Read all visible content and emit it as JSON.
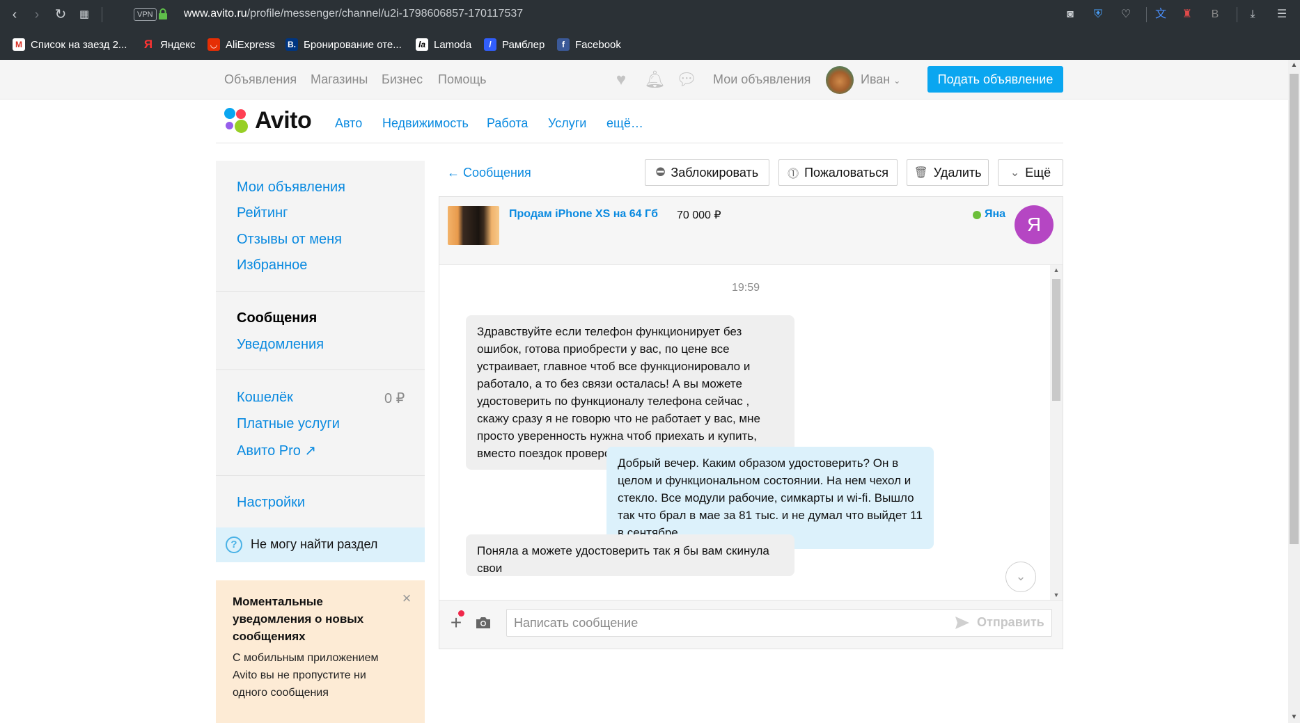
{
  "browser": {
    "vpn_label": "VPN",
    "url_domain": "www.avito.ru",
    "url_path": "/profile/messenger/channel/u2i-1798606857-170117537",
    "bookmarks": [
      {
        "label": "Список на заезд 2...",
        "icon": "gmail-icon",
        "color": "#d93025"
      },
      {
        "label": "Яндекс",
        "icon": "yandex-icon",
        "color": "#ff0000"
      },
      {
        "label": "AliExpress",
        "icon": "aliexpress-icon",
        "color": "#e62e04"
      },
      {
        "label": "Бронирование оте...",
        "icon": "booking-icon",
        "color": "#003580"
      },
      {
        "label": "Lamoda",
        "icon": "lamoda-icon",
        "color": "#000000"
      },
      {
        "label": "Рамблер",
        "icon": "rambler-icon",
        "color": "#315efb"
      },
      {
        "label": "Facebook",
        "icon": "facebook-icon",
        "color": "#3b5998"
      }
    ]
  },
  "topbar": {
    "links": [
      "Объявления",
      "Магазины",
      "Бизнес",
      "Помощь"
    ],
    "my_ads": "Мои объявления",
    "user_name": "Иван",
    "post_button": "Подать объявление"
  },
  "header": {
    "logo_text": "Avito",
    "categories": [
      "Авто",
      "Недвижимость",
      "Работа",
      "Услуги",
      "ещё…"
    ]
  },
  "sidebar": {
    "group1": [
      "Мои объявления",
      "Рейтинг",
      "Отзывы от меня",
      "Избранное"
    ],
    "messages_active": "Сообщения",
    "notifications": "Уведомления",
    "wallet_label": "Кошелёк",
    "wallet_value": "0 ₽",
    "paid_services": "Платные услуги",
    "avito_pro": "Авито Pro ↗",
    "settings": "Настройки",
    "help": "Не могу найти раздел"
  },
  "promo": {
    "title": "Моментальные уведомления о новых сообщениях",
    "text": "С мобильным приложением Avito вы не пропустите ни одного сообщения"
  },
  "chat": {
    "back_label": "← Сообщения",
    "actions": {
      "block": "Заблокировать",
      "report": "Пожаловаться",
      "delete": "Удалить",
      "more": "Ещё"
    },
    "item_title": "Продам iPhone XS на 64 Гб",
    "item_price": "70 000 ₽",
    "seller_name": "Яна",
    "seller_initial": "Я",
    "time": "19:59",
    "messages": [
      {
        "direction": "in",
        "text": "Здравствуйте если телефон функционирует без ошибок, готова приобрести у вас, по цене все устраивает, главное чтоб все функционировало и работало, а то без связи осталась! А вы можете удостоверить по функционалу телефона сейчас , скажу сразу я не говорю что не работает у вас, мне просто уверенность нужна чтоб приехать и купить, вместо поездок проверок у каждого)"
      },
      {
        "direction": "out",
        "text": "Добрый вечер. Каким образом удостоверить? Он в целом и функциональном состоянии. На нем чехол и стекло. Все модули рабочие, симкарты и wi-fi. Вышло так что брал в мае за 81 тыс. и не думал что выйдет 11 в сентябре."
      },
      {
        "direction": "in",
        "text": "Поняла а можете  удостоверить так я бы вам скинула свои"
      }
    ],
    "input_placeholder": "Написать сообщение",
    "send_label": "Отправить"
  }
}
